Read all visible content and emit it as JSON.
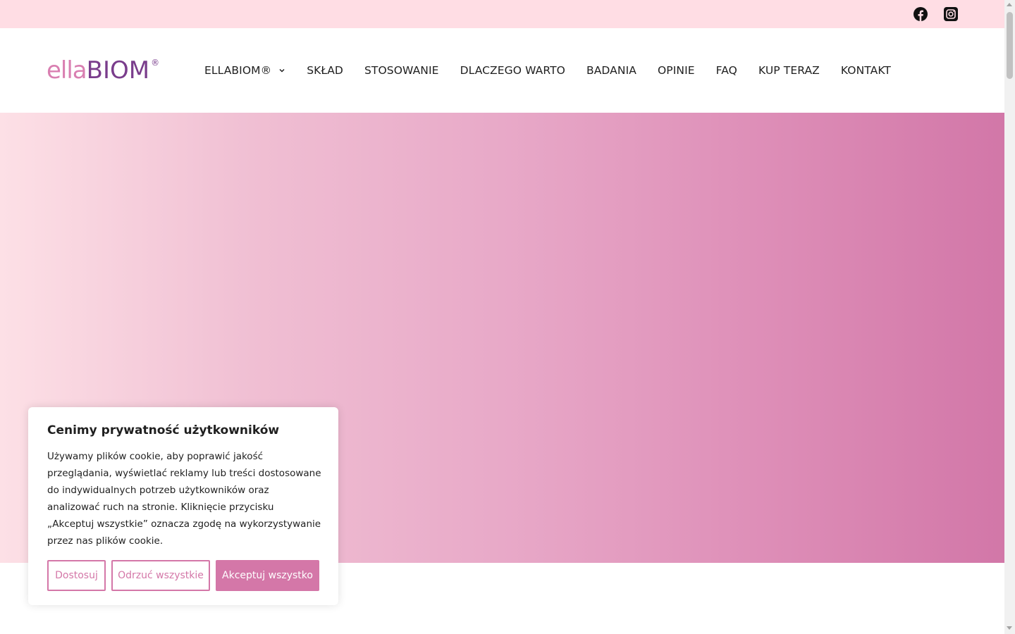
{
  "topbar": {
    "social_icons": [
      "facebook-icon",
      "instagram-icon"
    ]
  },
  "header": {
    "logo": {
      "part1": "ella",
      "part2": "BIOM",
      "mark": "®"
    },
    "nav": [
      {
        "label": "ELLABIOM®",
        "has_dropdown": true
      },
      {
        "label": "SKŁAD"
      },
      {
        "label": "STOSOWANIE"
      },
      {
        "label": "DLACZEGO WARTO"
      },
      {
        "label": "BADANIA"
      },
      {
        "label": "OPINIE"
      },
      {
        "label": "FAQ"
      },
      {
        "label": "KUP TERAZ"
      },
      {
        "label": "KONTAKT"
      }
    ]
  },
  "cookie": {
    "title": "Cenimy prywatność użytkowników",
    "text": "Używamy plików cookie, aby poprawić jakość przeglądania, wyświetlać reklamy lub treści dostosowane do indywidualnych potrzeb użytkowników oraz analizować ruch na stronie. Kliknięcie przycisku „Akceptuj wszystkie” oznacza zgodę na wykorzystywanie przez nas plików cookie.",
    "buttons": {
      "customize": "Dostosuj",
      "reject": "Odrzuć wszystkie",
      "accept": "Akceptuj wszystko"
    }
  },
  "colors": {
    "accent": "#d477a8",
    "topbar_bg": "#ffdde4",
    "logo_pink": "#d97fb1",
    "logo_purple": "#7a3d8c"
  }
}
